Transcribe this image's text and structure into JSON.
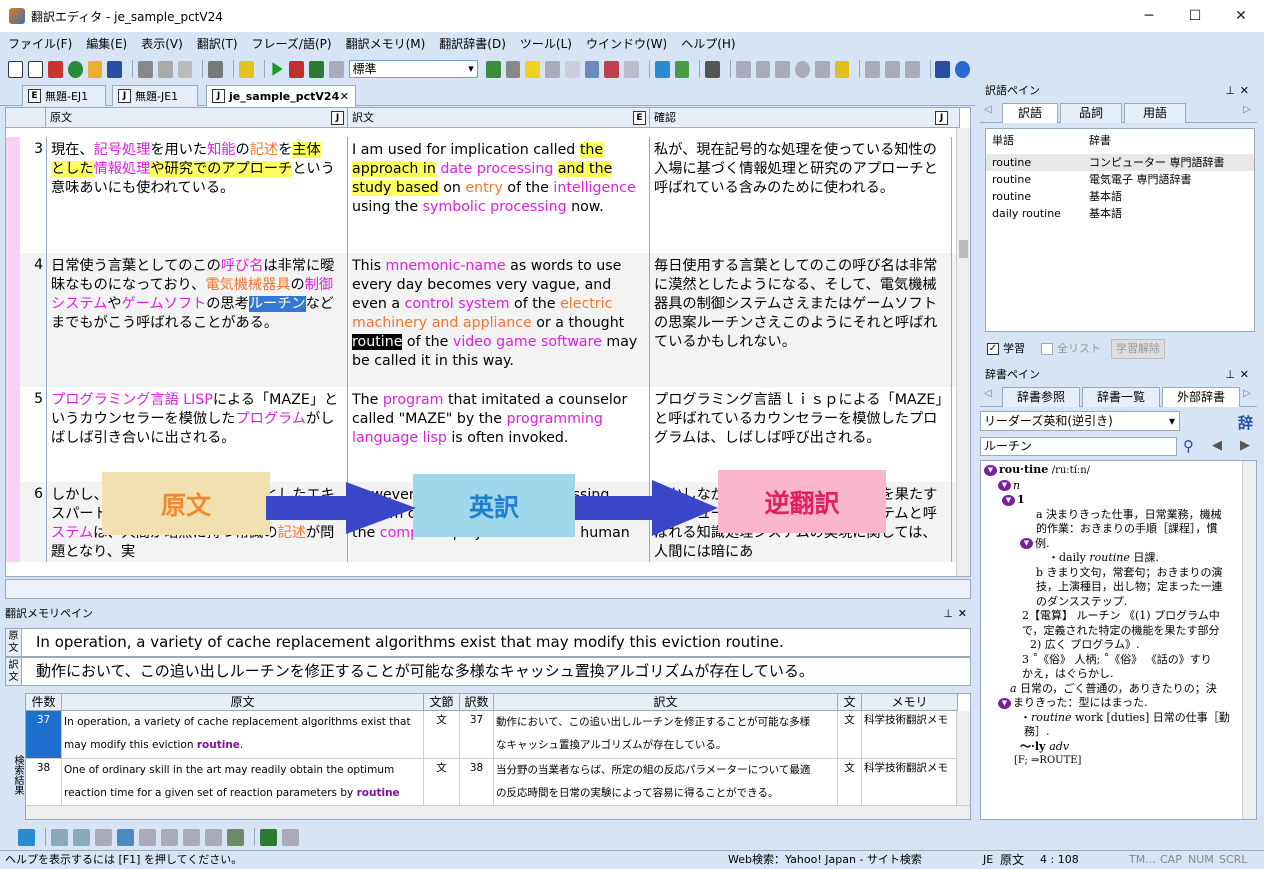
{
  "window": {
    "title": "翻訳エディタ - je_sample_pctV24",
    "btn_min": "─",
    "btn_max": "☐",
    "btn_close": "✕"
  },
  "menu": [
    "ファイル(F)",
    "編集(E)",
    "表示(V)",
    "翻訳(T)",
    "フレーズ/語(P)",
    "翻訳メモリ(M)",
    "翻訳辞書(D)",
    "ツール(L)",
    "ウインドウ(W)",
    "ヘルプ(H)"
  ],
  "toolbar": {
    "combo_value": "標準"
  },
  "tabs": [
    {
      "icon": "E",
      "label": "無題-EJ1"
    },
    {
      "icon": "J",
      "label": "無題-JE1"
    },
    {
      "icon": "J",
      "label": "je_sample_pctV24"
    }
  ],
  "grid": {
    "headers": {
      "source": "原文",
      "translation": "訳文",
      "check": "確認",
      "src_icon": "J",
      "tr_icon": "E",
      "ck_icon": "J"
    },
    "rows": [
      {
        "num": "3"
      },
      {
        "num": "4"
      },
      {
        "num": "5"
      },
      {
        "num": "6"
      }
    ]
  },
  "flow": {
    "a": "原文",
    "b": "英訳",
    "c": "逆翻訳"
  },
  "tm": {
    "title": "翻訳メモリペイン",
    "src_label": "原文",
    "tr_label": "訳文",
    "source": "In operation, a variety of cache replacement algorithms exist that may modify this eviction routine.",
    "translation": "動作において、この追い出しルーチンを修正することが可能な多様なキャッシュ置換アルゴリズムが存在している。",
    "side_label": "検索結果",
    "columns": [
      "件数",
      "原文",
      "文節",
      "訳数",
      "訳文",
      "文",
      "メモリ"
    ],
    "results": [
      {
        "n": "37",
        "src1": "In operation, a variety of cache replacement algorithms exist that",
        "src2a": "may modify this eviction ",
        "src2b": "routine",
        "src2c": ".",
        "kind": "文",
        "cnt": "37",
        "tr1": "動作において、この追い出しルーチンを修正することが可能な多様",
        "tr2": "なキャッシュ置換アルゴリズムが存在している。",
        "k2": "文",
        "mem": "科学技術翻訳メモ"
      },
      {
        "n": "38",
        "src1": "One of ordinary skill in the art may readily obtain the optimum",
        "src2a": "reaction time for a given set of reaction parameters by ",
        "src2b": "routine",
        "src2c": "",
        "kind": "文",
        "cnt": "38",
        "tr1": "当分野の当業者ならば、所定の組の反応パラメーターについて最適",
        "tr2": "の反応時間を日常の実験によって容易に得ることができる。",
        "k2": "文",
        "mem": "科学技術翻訳メモ"
      }
    ]
  },
  "yaku": {
    "title": "訳語ペイン",
    "tabs": [
      "訳語",
      "品詞",
      "用語"
    ],
    "cols": [
      "単語",
      "辞書"
    ],
    "rows": [
      [
        "routine",
        "コンピューター 専門語辞書"
      ],
      [
        "routine",
        "電気電子 専門語辞書"
      ],
      [
        "routine",
        "基本語"
      ],
      [
        "daily routine",
        "基本語"
      ]
    ],
    "chk_learn": "学習",
    "chk_all": "全リスト",
    "btn_unlearn": "学習解除"
  },
  "dict": {
    "title": "辞書ペイン",
    "tabs": [
      "辞書参照",
      "辞書一覧",
      "外部辞書"
    ],
    "dict_select": "リーダーズ英和(逆引き)",
    "side_char": "辞",
    "search": "ルーチン",
    "hw": "rou·tine",
    "pron": "/ruːtíːn/",
    "pos_n": "n",
    "sense1": "1",
    "l1": "a 決まりきった仕事，日常業務，機械",
    "l2": "的作業：おきまりの手順［課程］，慣",
    "l3": "例.",
    "l4a": "・daily ",
    "l4b": "routine",
    "l4c": " 日課.",
    "l5": "b きまり文句，常套句；おきまりの演",
    "l6": "技，上演種目，出し物；定まった一連",
    "l7": "のダンスステップ.",
    "l8": "2【電算】 ルーチン 《(1) プログラム中",
    "l9": "で，定義された特定の機能を果たす部分",
    "l10": "2) 広く プログラム》.",
    "l11": "3 ˚《俗》 人柄; ˚《俗》 《話の》すり",
    "l12": "かえ，はぐらかし.",
    "l13a": "a",
    "l13b": " 日常の，ごく普通の，ありきたりの；決",
    "l14": "まりきった：型にはまった.",
    "l15a": "・",
    "l15b": "routine",
    "l15c": " work [duties] 日常の仕事［勤",
    "l16": "務］.",
    "l17": "～·ly ",
    "l17b": "adv",
    "l18": "[F; ⇒ROUTE]"
  },
  "status": {
    "help": "ヘルプを表示するには [F1] を押してください。",
    "web": "Web検索：Yahoo! Japan - サイト検索",
    "lang": "JE",
    "mode": "原文",
    "pos": "4 : 108",
    "tm": "TM...",
    "cap": "CAP",
    "num": "NUM",
    "scrl": "SCRL"
  },
  "colors": {
    "accent": "#3478d0",
    "magenta": "#e020e0",
    "orange": "#f07830",
    "highlight": "#ffff60"
  }
}
